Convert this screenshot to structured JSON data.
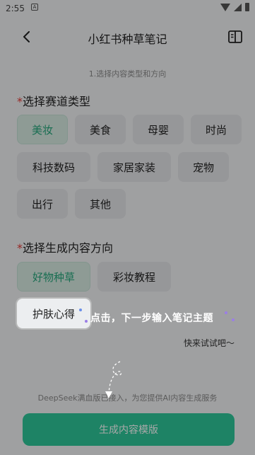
{
  "status_bar": {
    "time": "2:55",
    "notif_glyph": "A"
  },
  "header": {
    "title": "小红书种草笔记"
  },
  "step_label": "1.选择内容类型和方向",
  "section1": {
    "required_mark": "*",
    "title": "选择赛道类型",
    "chips": [
      "美妆",
      "美食",
      "母婴",
      "时尚",
      "科技数码",
      "家居家装",
      "宠物",
      "出行",
      "其他"
    ],
    "selected": "美妆"
  },
  "section2": {
    "required_mark": "*",
    "title": "选择生成内容方向",
    "chips": [
      "好物种草",
      "彩妆教程",
      "护肤心得"
    ],
    "selected": "好物种草"
  },
  "guide": {
    "text": "点击，下一步输入笔记主题",
    "sub": "快来试试吧～"
  },
  "hint": "DeepSeek满血版已接入，为您提供AI内容生成服务",
  "generate_button": "生成内容模版",
  "colors": {
    "accent": "#2ec79a",
    "accent_text": "#25a77b",
    "required": "#e53935"
  }
}
